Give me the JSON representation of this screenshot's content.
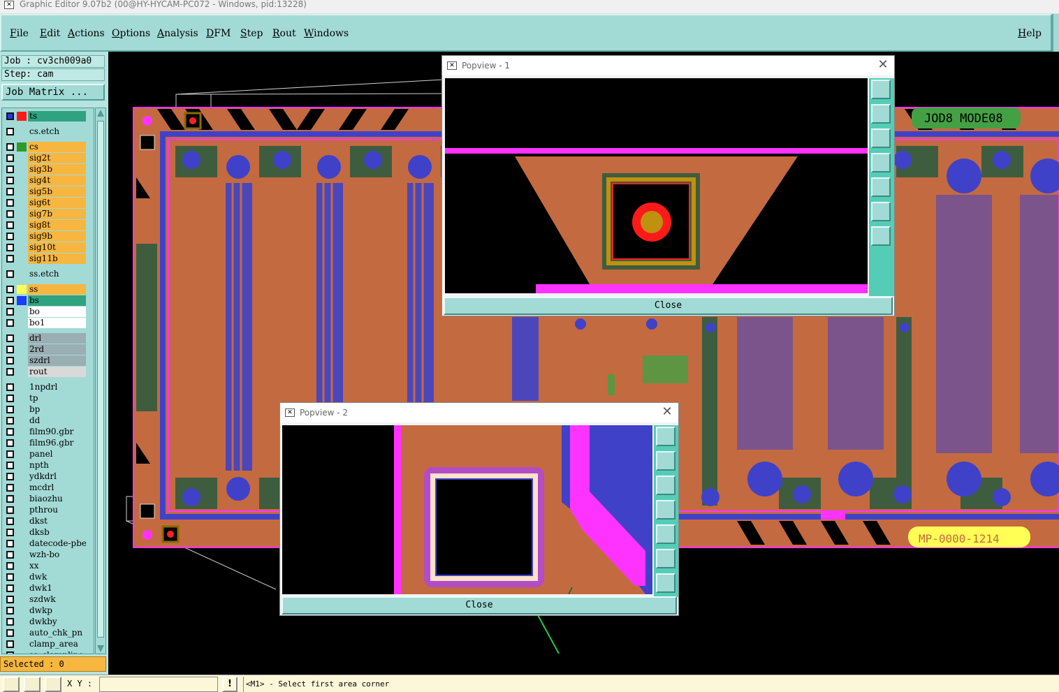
{
  "window": {
    "title": "Graphic Editor 9.07b2 (00@HY-HYCAM-PC072 - Windows, pid:13228)",
    "icon": "app-x-icon"
  },
  "menu": {
    "items": [
      "File",
      "Edit",
      "Actions",
      "Options",
      "Analysis",
      "DFM",
      "Step",
      "Rout",
      "Windows"
    ],
    "help": "Help"
  },
  "panel": {
    "job": "Job : cv3ch009a0",
    "step": "Step: cam",
    "job_matrix": "Job Matrix ...",
    "selected": "Selected : 0",
    "layers": [
      {
        "name": "ts",
        "color": "#2fa37f",
        "swatch": "#ff1a1a",
        "active": true
      },
      {
        "name": "cs.etch",
        "color": "#a2dad6"
      },
      {
        "name": "cs",
        "color": "#f6b640",
        "swatch": "#2e9a2e"
      },
      {
        "name": "sig2t",
        "color": "#f6b640"
      },
      {
        "name": "sig3b",
        "color": "#f6b640"
      },
      {
        "name": "sig4t",
        "color": "#f6b640"
      },
      {
        "name": "sig5b",
        "color": "#f6b640"
      },
      {
        "name": "sig6t",
        "color": "#f6b640"
      },
      {
        "name": "sig7b",
        "color": "#f6b640"
      },
      {
        "name": "sig8t",
        "color": "#f6b640"
      },
      {
        "name": "sig9b",
        "color": "#f6b640"
      },
      {
        "name": "sig10t",
        "color": "#f6b640"
      },
      {
        "name": "sig11b",
        "color": "#f6b640"
      },
      {
        "name": "ss.etch",
        "color": "#a2dad6"
      },
      {
        "name": "ss",
        "color": "#f6b640",
        "swatch": "#ffff55"
      },
      {
        "name": "bs",
        "color": "#2fa37f",
        "swatch": "#1a3cff"
      },
      {
        "name": "bo",
        "color": "#ffffff"
      },
      {
        "name": "bo1",
        "color": "#ffffff"
      },
      {
        "name": "drl",
        "color": "#9aaeb3"
      },
      {
        "name": "2rd",
        "color": "#9aaeb3"
      },
      {
        "name": "szdrl",
        "color": "#9aaeb3"
      },
      {
        "name": "rout",
        "color": "#d9d9d9"
      },
      {
        "name": "1npdrl",
        "color": "#a2dad6"
      },
      {
        "name": "tp",
        "color": "#a2dad6"
      },
      {
        "name": "bp",
        "color": "#a2dad6"
      },
      {
        "name": "dd",
        "color": "#a2dad6"
      },
      {
        "name": "film90.gbr",
        "color": "#a2dad6"
      },
      {
        "name": "film96.gbr",
        "color": "#a2dad6"
      },
      {
        "name": "panel",
        "color": "#a2dad6"
      },
      {
        "name": "npth",
        "color": "#a2dad6"
      },
      {
        "name": "ydkdrl",
        "color": "#a2dad6"
      },
      {
        "name": "mcdrl",
        "color": "#a2dad6"
      },
      {
        "name": "biaozhu",
        "color": "#a2dad6"
      },
      {
        "name": "pthrou",
        "color": "#a2dad6"
      },
      {
        "name": "dkst",
        "color": "#a2dad6"
      },
      {
        "name": "dksb",
        "color": "#a2dad6"
      },
      {
        "name": "datecode-pbe",
        "color": "#a2dad6"
      },
      {
        "name": "wzh-bo",
        "color": "#a2dad6"
      },
      {
        "name": "xx",
        "color": "#a2dad6"
      },
      {
        "name": "dwk",
        "color": "#a2dad6"
      },
      {
        "name": "dwk1",
        "color": "#a2dad6"
      },
      {
        "name": "szdwk",
        "color": "#a2dad6"
      },
      {
        "name": "dwkp",
        "color": "#a2dad6"
      },
      {
        "name": "dwkby",
        "color": "#a2dad6"
      },
      {
        "name": "auto_chk_pn",
        "color": "#a2dad6"
      },
      {
        "name": "clamp_area",
        "color": "#a2dad6"
      },
      {
        "name": "ss_clampline",
        "color": "#a2dad6"
      }
    ]
  },
  "board": {
    "text_top": "JOD8 MODE08",
    "text_bottom": "MP-0000-1214"
  },
  "popview1": {
    "title": "Popview - 1",
    "close": "Close",
    "close_x": "✕"
  },
  "popview2": {
    "title": "Popview - 2",
    "close": "Close",
    "close_x": "✕"
  },
  "status": {
    "xy_label": "X Y :",
    "xy_value": "",
    "warn": "!",
    "message": "<M1> - Select first area corner"
  }
}
